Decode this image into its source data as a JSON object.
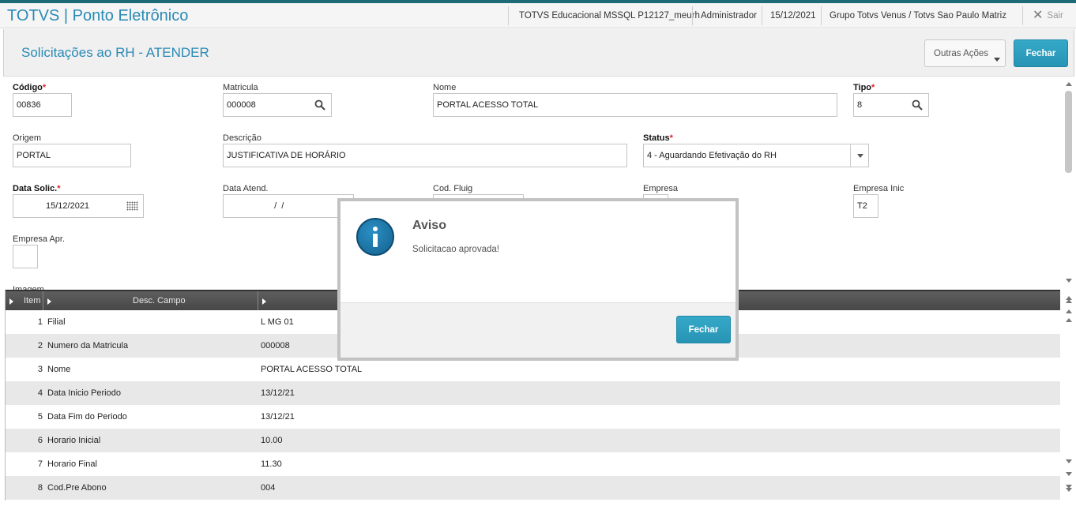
{
  "app": {
    "title": "TOTVS | Ponto Eletrônico",
    "environment": "TOTVS Educacional MSSQL P12127_meurh",
    "user": "Administrador",
    "date": "15/12/2021",
    "company": "Grupo Totvs Venus / Totvs Sao Paulo Matriz",
    "exit_label": "Sair",
    "exit_icon": "close-icon"
  },
  "page": {
    "title": "Solicitações ao RH - ATENDER",
    "other_actions_label": "Outras Ações",
    "close_label": "Fechar"
  },
  "form": {
    "codigo": {
      "label": "Código",
      "value": "00836",
      "required": true
    },
    "matricula": {
      "label": "Matricula",
      "value": "000008",
      "icon": "search-icon"
    },
    "nome": {
      "label": "Nome",
      "value": "PORTAL ACESSO TOTAL"
    },
    "tipo": {
      "label": "Tipo",
      "value": "8",
      "required": true,
      "icon": "search-icon"
    },
    "origem": {
      "label": "Origem",
      "value": "PORTAL"
    },
    "descricao": {
      "label": "Descrição",
      "value": "JUSTIFICATIVA DE HORÁRIO"
    },
    "status": {
      "label": "Status",
      "value": "4 - Aguardando Efetivação do RH",
      "required": true
    },
    "data_solic": {
      "label": "Data Solic.",
      "value": "15/12/2021",
      "required": true,
      "icon": "calendar-icon"
    },
    "data_atend": {
      "label": "Data Atend.",
      "value": "  /  /"
    },
    "cod_fluig": {
      "label": "Cod. Fluig",
      "value": ""
    },
    "empresa": {
      "label": "Empresa",
      "value": ""
    },
    "empresa_inic": {
      "label": "Empresa Inic",
      "value": "T2"
    },
    "empresa_apr": {
      "label": "Empresa Apr.",
      "value": ""
    },
    "imagem": {
      "label": "Imagem"
    }
  },
  "grid": {
    "columns": [
      "Item",
      "Desc. Campo",
      ""
    ],
    "rows": [
      {
        "item": "1",
        "campo": "Filial",
        "valor": "L MG 01"
      },
      {
        "item": "2",
        "campo": "Numero da Matricula",
        "valor": "000008"
      },
      {
        "item": "3",
        "campo": "Nome",
        "valor": "PORTAL ACESSO TOTAL"
      },
      {
        "item": "4",
        "campo": "Data Inicio Periodo",
        "valor": "13/12/21"
      },
      {
        "item": "5",
        "campo": "Data Fim do Periodo",
        "valor": "13/12/21"
      },
      {
        "item": "6",
        "campo": "Horario Inicial",
        "valor": "10.00"
      },
      {
        "item": "7",
        "campo": "Horario Final",
        "valor": "11.30"
      },
      {
        "item": "8",
        "campo": "Cod.Pre Abono",
        "valor": "004"
      }
    ]
  },
  "dialog": {
    "title": "Aviso",
    "message": "Solicitacao aprovada!",
    "button_label": "Fechar",
    "icon": "info-icon"
  },
  "colors": {
    "brand": "#2a8ab5",
    "primary_button": "#2794b4",
    "required": "#e0202a",
    "grid_header": "#4f4f4f"
  }
}
